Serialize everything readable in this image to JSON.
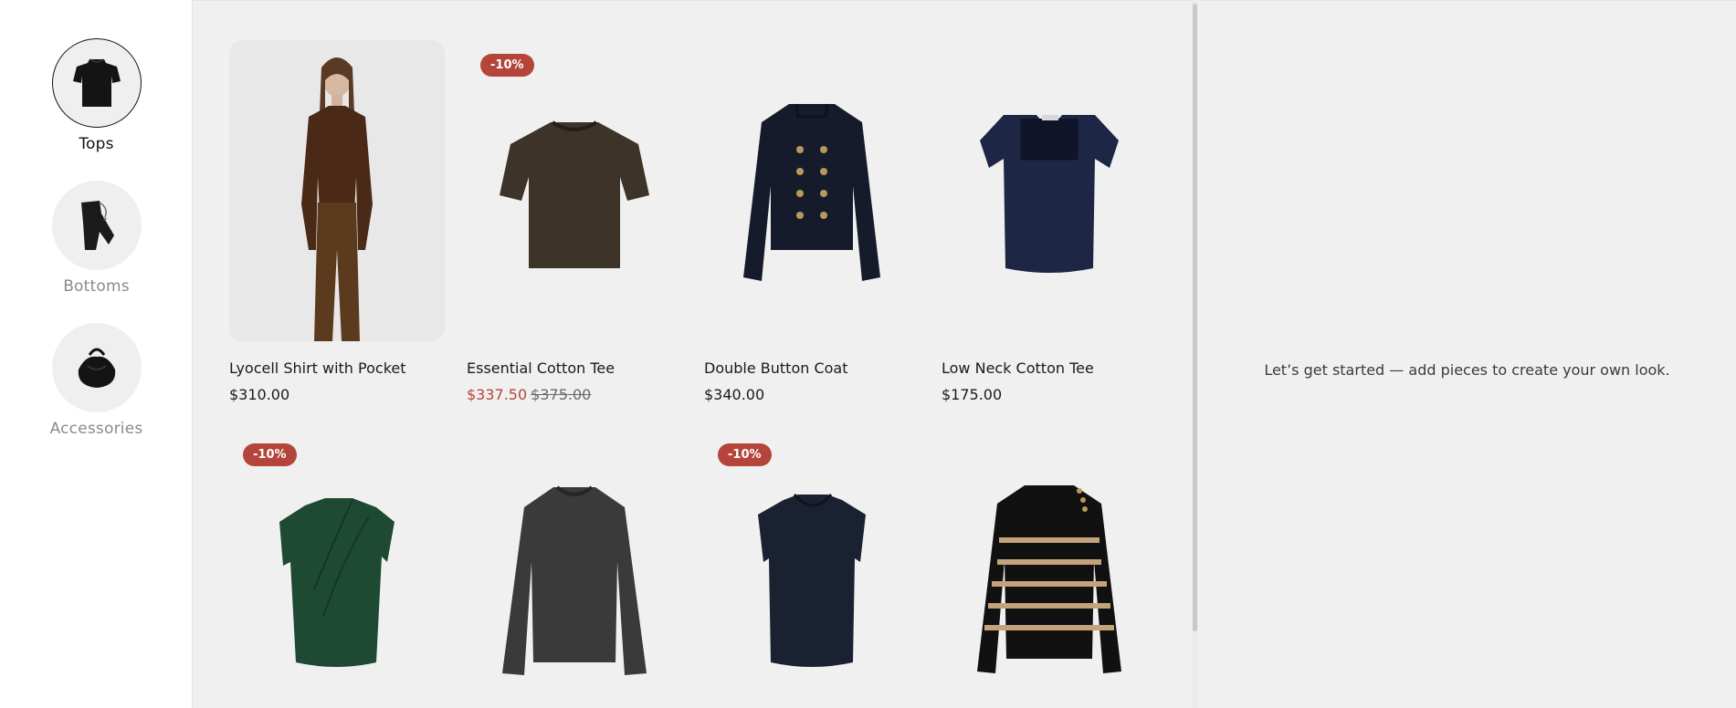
{
  "categories": [
    {
      "label": "Tops",
      "icon": "top-icon",
      "active": true
    },
    {
      "label": "Bottoms",
      "icon": "trousers-icon",
      "active": false
    },
    {
      "label": "Accessories",
      "icon": "handbag-icon",
      "active": false
    }
  ],
  "products": [
    {
      "name": "Lyocell Shirt with Pocket",
      "price": "$310.00",
      "icon": "brown-shirt-outfit-icon"
    },
    {
      "name": "Essential Cotton Tee",
      "sale_price": "$337.50",
      "original_price": "$375.00",
      "badge": "-10%",
      "icon": "brown-tshirt-icon"
    },
    {
      "name": "Double Button Coat",
      "price": "$340.00",
      "icon": "navy-double-button-coat-icon"
    },
    {
      "name": "Low Neck Cotton Tee",
      "price": "$175.00",
      "icon": "navy-low-neck-tee-icon"
    },
    {
      "badge": "-10%",
      "icon": "green-draped-top-icon"
    },
    {
      "icon": "charcoal-knit-sweater-icon"
    },
    {
      "badge": "-10%",
      "icon": "navy-sleeveless-top-icon"
    },
    {
      "icon": "striped-sweater-icon"
    }
  ],
  "look_panel": {
    "empty_message": "Let’s get started — add pieces to create your own look."
  },
  "colors": {
    "accent": "#b5453a",
    "panel_background": "#f0f0f0"
  }
}
